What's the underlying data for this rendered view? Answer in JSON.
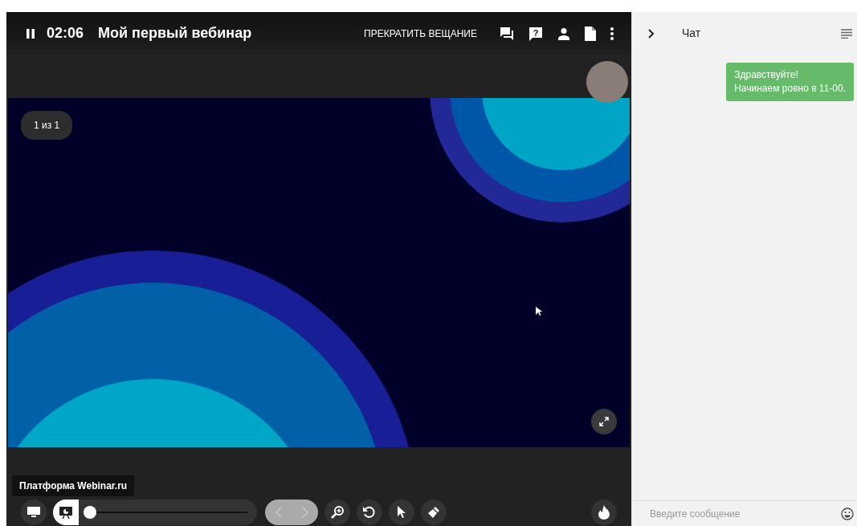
{
  "header": {
    "time": "02:06",
    "title": "Мой первый вебинар",
    "stop_button": "ПРЕКРАТИТЬ ВЕЩАНИЕ",
    "question_glyph": "?"
  },
  "slide": {
    "counter": "1 из 1"
  },
  "toolbar": {
    "tooltip": "Платформа Webinar.ru",
    "view_modes": [
      {
        "selected": false
      },
      {
        "selected": true
      }
    ],
    "slider": {
      "level": 0
    },
    "prev_disabled": true,
    "next_disabled": true
  },
  "chat": {
    "title": "Чат",
    "messages": [
      {
        "text": "Здравствуйте!\nНачинаем ровно в 11-00.",
        "color": "#66bb6a"
      }
    ],
    "input": {
      "placeholder": "Введите сообщение"
    }
  }
}
